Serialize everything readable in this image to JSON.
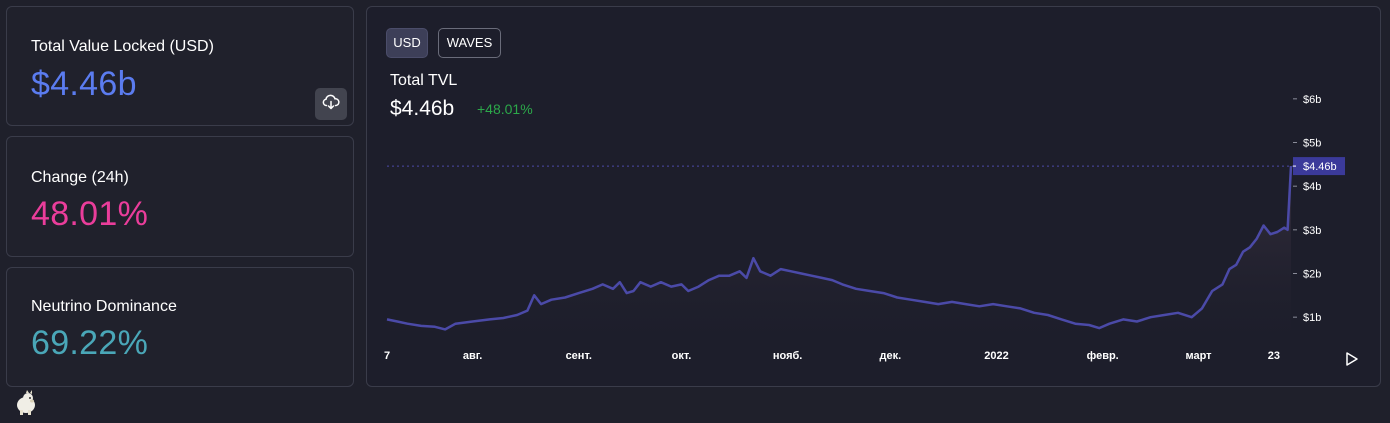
{
  "cards": {
    "tvl": {
      "label": "Total Value Locked (USD)",
      "value": "$4.46b",
      "color": "#5b7cf0"
    },
    "change": {
      "label": "Change (24h)",
      "value": "48.01%",
      "color": "#ea3d9b"
    },
    "dominance": {
      "label": "Neutrino Dominance",
      "value": "69.22%",
      "color": "#4aa7b8"
    }
  },
  "icons": {
    "download": "cloud-download-icon",
    "play": "play-icon",
    "mascot": "llama-icon"
  },
  "chart_panel": {
    "toggle_usd": "USD",
    "toggle_waves": "WAVES",
    "title": "Total TVL",
    "value": "$4.46b",
    "change": "+48.01%",
    "current_label": "$4.46b"
  },
  "chart_data": {
    "type": "area",
    "title": "Total TVL",
    "line_color": "#4b4aa8",
    "y_ticks": [
      "$1b",
      "$2b",
      "$3b",
      "$4b",
      "$5b",
      "$6b"
    ],
    "y_tick_values": [
      1,
      2,
      3,
      4,
      5,
      6
    ],
    "ylim": [
      0.5,
      6.5
    ],
    "x_ticks": [
      "7",
      "авг.",
      "сент.",
      "окт.",
      "нояб.",
      "дек.",
      "2022",
      "февр.",
      "март",
      "23"
    ],
    "x_tick_days": [
      0,
      25,
      56,
      86,
      117,
      147,
      178,
      209,
      237,
      259
    ],
    "xlim": [
      0,
      264
    ],
    "series": [
      {
        "unit": "billions USD",
        "points": [
          [
            0,
            0.95
          ],
          [
            3,
            0.9
          ],
          [
            6,
            0.85
          ],
          [
            10,
            0.8
          ],
          [
            14,
            0.78
          ],
          [
            17,
            0.72
          ],
          [
            20,
            0.85
          ],
          [
            25,
            0.9
          ],
          [
            30,
            0.95
          ],
          [
            34,
            0.98
          ],
          [
            38,
            1.05
          ],
          [
            41,
            1.15
          ],
          [
            43,
            1.5
          ],
          [
            45,
            1.3
          ],
          [
            48,
            1.4
          ],
          [
            52,
            1.45
          ],
          [
            56,
            1.55
          ],
          [
            60,
            1.65
          ],
          [
            63,
            1.75
          ],
          [
            66,
            1.65
          ],
          [
            68,
            1.8
          ],
          [
            70,
            1.55
          ],
          [
            72,
            1.6
          ],
          [
            74,
            1.8
          ],
          [
            77,
            1.7
          ],
          [
            80,
            1.8
          ],
          [
            83,
            1.7
          ],
          [
            86,
            1.75
          ],
          [
            88,
            1.6
          ],
          [
            91,
            1.7
          ],
          [
            94,
            1.85
          ],
          [
            97,
            1.95
          ],
          [
            100,
            1.95
          ],
          [
            103,
            2.05
          ],
          [
            105,
            1.9
          ],
          [
            107,
            2.35
          ],
          [
            109,
            2.05
          ],
          [
            112,
            1.95
          ],
          [
            115,
            2.1
          ],
          [
            118,
            2.05
          ],
          [
            121,
            2.0
          ],
          [
            124,
            1.95
          ],
          [
            127,
            1.9
          ],
          [
            130,
            1.85
          ],
          [
            133,
            1.75
          ],
          [
            137,
            1.65
          ],
          [
            141,
            1.6
          ],
          [
            145,
            1.55
          ],
          [
            149,
            1.45
          ],
          [
            153,
            1.4
          ],
          [
            157,
            1.35
          ],
          [
            161,
            1.3
          ],
          [
            165,
            1.35
          ],
          [
            169,
            1.3
          ],
          [
            173,
            1.25
          ],
          [
            177,
            1.3
          ],
          [
            181,
            1.25
          ],
          [
            185,
            1.2
          ],
          [
            189,
            1.1
          ],
          [
            193,
            1.05
          ],
          [
            197,
            0.95
          ],
          [
            201,
            0.85
          ],
          [
            205,
            0.82
          ],
          [
            208,
            0.75
          ],
          [
            211,
            0.85
          ],
          [
            215,
            0.95
          ],
          [
            219,
            0.9
          ],
          [
            223,
            1.0
          ],
          [
            227,
            1.05
          ],
          [
            231,
            1.1
          ],
          [
            235,
            1.0
          ],
          [
            238,
            1.2
          ],
          [
            241,
            1.6
          ],
          [
            244,
            1.75
          ],
          [
            246,
            2.1
          ],
          [
            248,
            2.2
          ],
          [
            250,
            2.5
          ],
          [
            252,
            2.6
          ],
          [
            254,
            2.8
          ],
          [
            256,
            3.1
          ],
          [
            258,
            2.9
          ],
          [
            260,
            2.95
          ],
          [
            262,
            3.05
          ],
          [
            263,
            3.0
          ],
          [
            264,
            4.46
          ]
        ]
      }
    ]
  }
}
